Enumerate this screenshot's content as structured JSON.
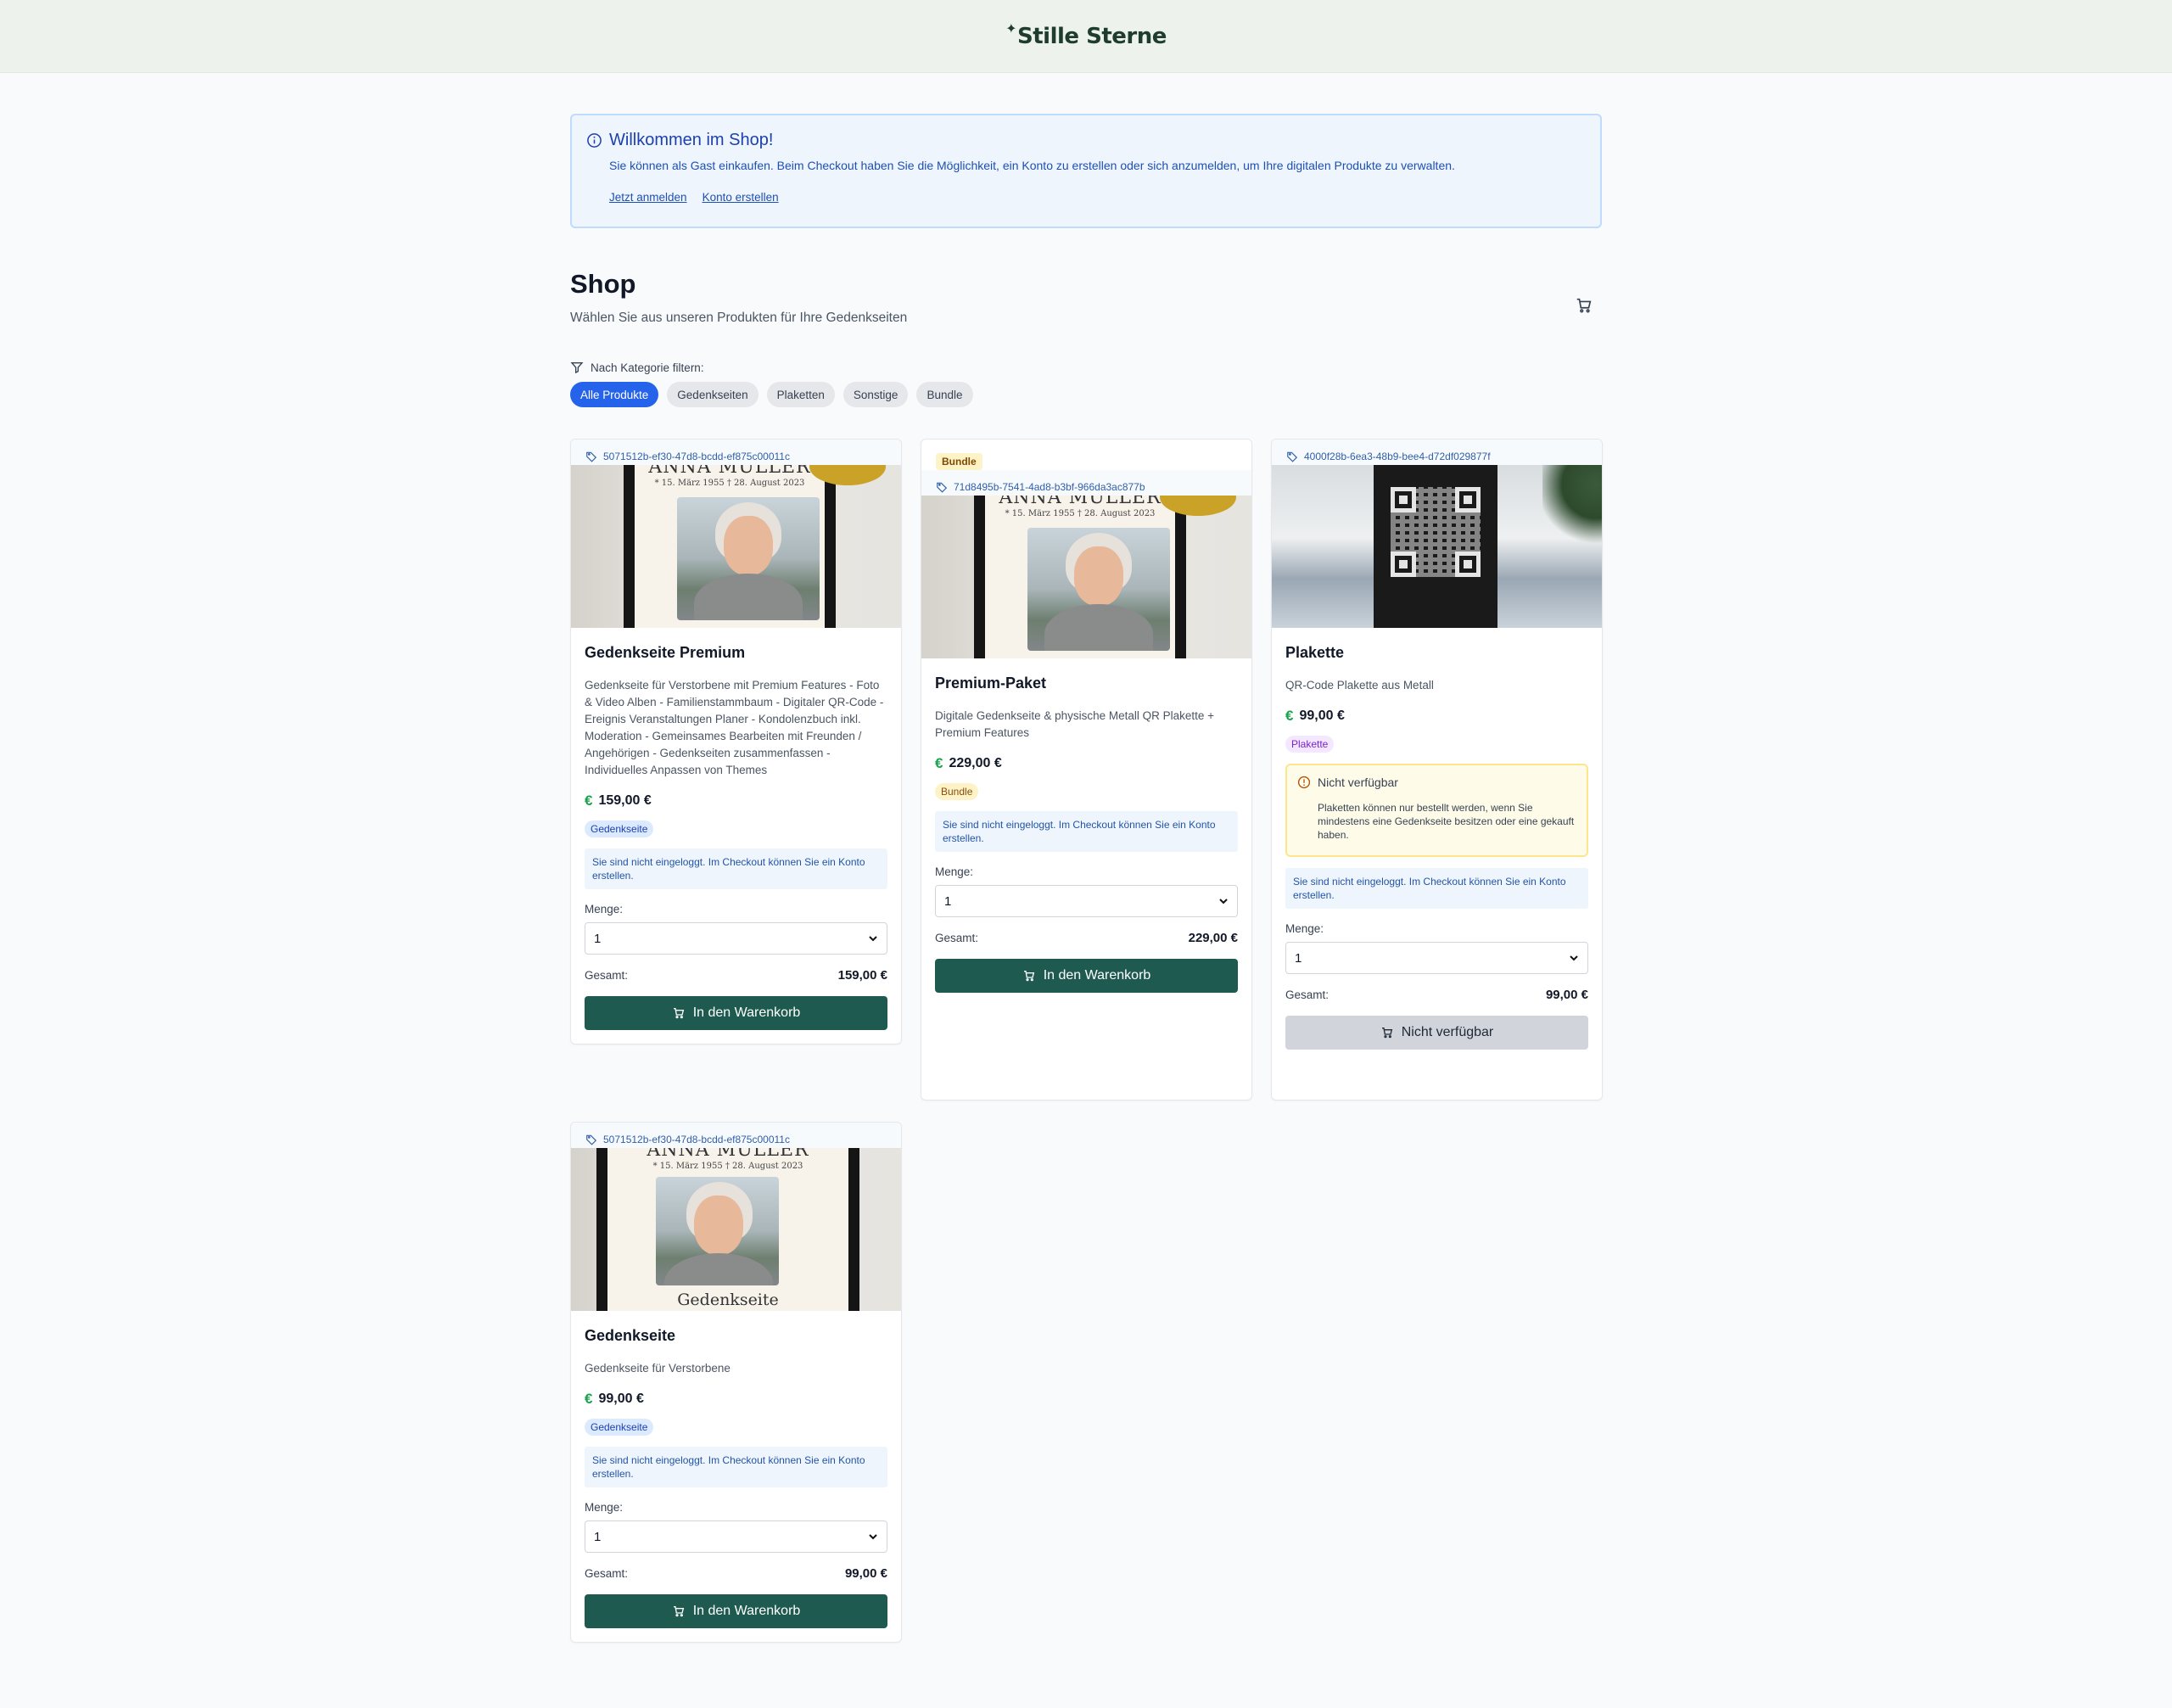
{
  "brand": {
    "name": "Stille Sterne",
    "star": "✦"
  },
  "welcome": {
    "title": "Willkommen im Shop!",
    "text": "Sie können als Gast einkaufen. Beim Checkout haben Sie die Möglichkeit, ein Konto zu erstellen oder sich anzumelden, um Ihre digitalen Produkte zu verwalten.",
    "login_link": "Jetzt anmelden",
    "register_link": "Konto erstellen"
  },
  "shop": {
    "title": "Shop",
    "subtitle": "Wählen Sie aus unseren Produkten für Ihre Gedenkseiten"
  },
  "filter": {
    "label": "Nach Kategorie filtern:",
    "chips": [
      "Alle Produkte",
      "Gedenkseiten",
      "Plaketten",
      "Sonstige",
      "Bundle"
    ],
    "active": "Alle Produkte"
  },
  "common": {
    "not_logged_in": "Sie sind nicht eingeloggt. Im Checkout können Sie ein Konto erstellen.",
    "qty_label": "Menge:",
    "qty_value": "1",
    "total_label": "Gesamt:",
    "add_to_cart": "In den Warenkorb",
    "unavailable_btn": "Nicht verfügbar",
    "currency_icon": "€"
  },
  "products": [
    {
      "sku": "5071512b-ef30-47d8-bcdd-ef875c00011c",
      "name": "Gedenkseite Premium",
      "description": "Gedenkseite für Verstorbene mit Premium Features - Foto & Video Alben - Familienstammbaum - Digitaler QR-Code - Ereignis Veranstaltungen Planer - Kondolenzbuch inkl. Moderation - Gemeinsames Bearbeiten mit Freunden / Angehörigen - Gedenkseiten zusammenfassen - Individuelles Anpassen von Themes",
      "price": "159,00 €",
      "category": "Gedenkseite",
      "total": "159,00 €",
      "poster_title": "ANNA MÜLLER",
      "poster_dates": "* 15. März 1955   † 28. August 2023"
    },
    {
      "tag": "Bundle",
      "sku": "71d8495b-7541-4ad8-b3bf-966da3ac877b",
      "name": "Premium-Paket",
      "description": "Digitale Gedenkseite & physische Metall QR Plakette + Premium Features",
      "price": "229,00 €",
      "category": "Bundle",
      "total": "229,00 €",
      "poster_title": "ANNA MÜLLER",
      "poster_dates": "* 15. März 1955   † 28. August 2023"
    },
    {
      "sku": "4000f28b-6ea3-48b9-bee4-d72df029877f",
      "name": "Plakette",
      "description": "QR-Code Plakette aus Metall",
      "price": "99,00 €",
      "category": "Plakette",
      "warning_title": "Nicht verfügbar",
      "warning_text": "Plaketten können nur bestellt werden, wenn Sie mindestens eine Gedenkseite besitzen oder eine gekauft haben.",
      "total": "99,00 €"
    },
    {
      "sku": "5071512b-ef30-47d8-bcdd-ef875c00011c",
      "name": "Gedenkseite",
      "description": "Gedenkseite für Verstorbene",
      "price": "99,00 €",
      "category": "Gedenkseite",
      "total": "99,00 €",
      "poster_title": "ANNA MÜLLER",
      "poster_dates": "* 15. März 1955   † 28. August 2023",
      "poster_foot": "Gedenkseite"
    }
  ],
  "colors": {
    "primary_button": "#1f5a50",
    "active_chip": "#2563eb",
    "info_bg": "#eef5fd"
  }
}
